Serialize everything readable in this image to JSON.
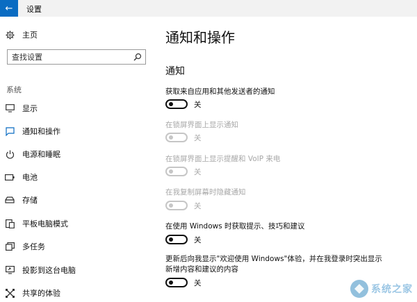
{
  "window": {
    "title": "设置",
    "back_icon": "arrow-left-icon"
  },
  "sidebar": {
    "home_label": "主页",
    "search_placeholder": "查找设置",
    "section": "系统",
    "items": [
      {
        "label": "显示",
        "icon": "monitor-icon",
        "active": false
      },
      {
        "label": "通知和操作",
        "icon": "message-icon",
        "active": true
      },
      {
        "label": "电源和睡眠",
        "icon": "power-icon",
        "active": false
      },
      {
        "label": "电池",
        "icon": "battery-icon",
        "active": false
      },
      {
        "label": "存储",
        "icon": "storage-icon",
        "active": false
      },
      {
        "label": "平板电脑模式",
        "icon": "tablet-icon",
        "active": false
      },
      {
        "label": "多任务",
        "icon": "multitask-icon",
        "active": false
      },
      {
        "label": "投影到这台电脑",
        "icon": "project-icon",
        "active": false
      },
      {
        "label": "共享的体验",
        "icon": "share-icon",
        "active": false
      }
    ]
  },
  "main": {
    "title": "通知和操作",
    "group_title": "通知",
    "settings": [
      {
        "label": "获取来自应用和其他发送者的通知",
        "state": "关",
        "enabled": true
      },
      {
        "label": "在锁屏界面上显示通知",
        "state": "关",
        "enabled": false
      },
      {
        "label": "在锁屏界面上显示提醒和 VoIP 来电",
        "state": "关",
        "enabled": false
      },
      {
        "label": "在我复制屏幕时隐藏通知",
        "state": "关",
        "enabled": false
      },
      {
        "label": "在使用 Windows 时获取提示、技巧和建议",
        "state": "关",
        "enabled": true
      },
      {
        "label": "更新后向我显示\"欢迎使用 Windows\"体验，并在我登录时突出显示新增内容和建议的内容",
        "state": "关",
        "enabled": true
      }
    ]
  },
  "watermark": {
    "text": "系统之家"
  }
}
